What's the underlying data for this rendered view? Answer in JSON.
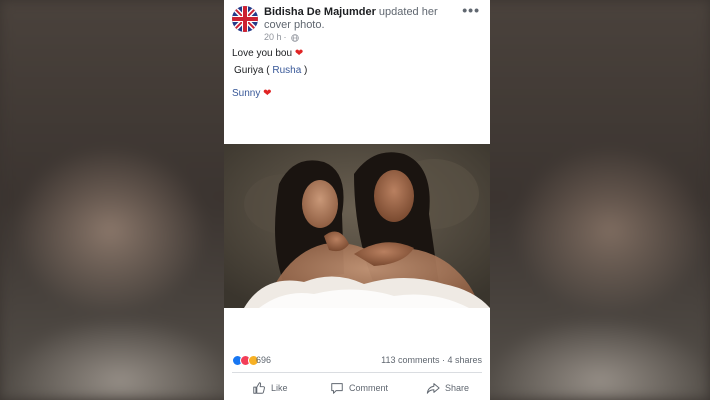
{
  "post": {
    "author": "Bidisha De Majumder",
    "action_text": " updated her cover photo.",
    "time": "20 h",
    "meta_separator": "·",
    "more_label": "•••",
    "caption": {
      "line1_text": "Love you bou ",
      "line1_emoji": "❤",
      "line2_prefix": "Guriya ( ",
      "line2_link": "Rusha",
      "line2_suffix": " )",
      "line3_link": "Sunny",
      "line3_emoji": "❤"
    },
    "reactions": {
      "count": "696",
      "comments": "113 comments",
      "separator": " · ",
      "shares": "4 shares"
    },
    "actions": {
      "like": "Like",
      "comment": "Comment",
      "share": "Share"
    }
  },
  "icons": {
    "more": "more-options-icon",
    "globe": "globe-icon",
    "like": "thumbs-up-icon",
    "comment": "speech-bubble-icon",
    "share": "share-arrow-icon"
  },
  "colors": {
    "link": "#385898",
    "heart": "#e02424",
    "like_reaction": "#1877f2",
    "love_reaction": "#f33e58",
    "wow_reaction": "#f7b125"
  }
}
